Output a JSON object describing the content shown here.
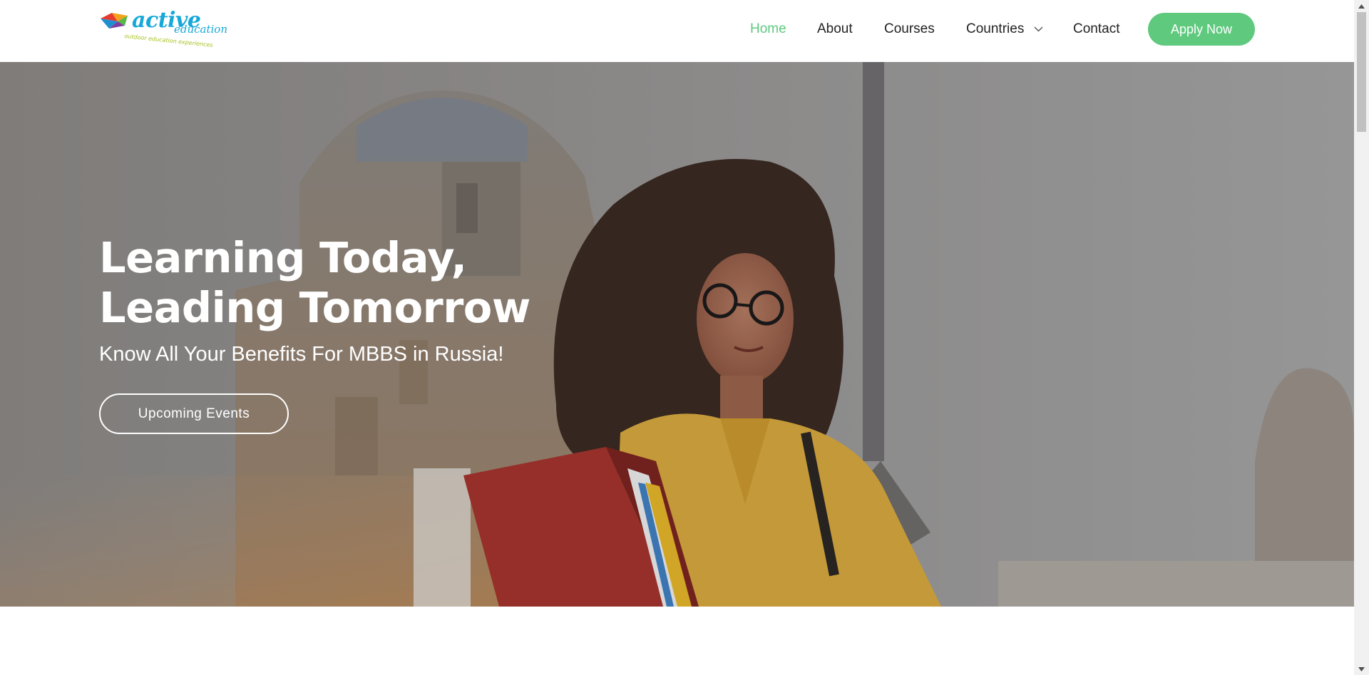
{
  "logo": {
    "word": "active",
    "word2": "education",
    "tagline": "outdoor education experiences",
    "icon": "kite-logo-icon"
  },
  "nav": {
    "items": [
      {
        "label": "Home",
        "active": true
      },
      {
        "label": "About",
        "active": false
      },
      {
        "label": "Courses",
        "active": false
      },
      {
        "label": "Countries",
        "active": false,
        "icon": "chevron-down-icon"
      },
      {
        "label": "Contact",
        "active": false
      }
    ],
    "cta_label": "Apply Now"
  },
  "hero": {
    "title_line1": "Learning Today,",
    "title_line2": "Leading Tomorrow",
    "subtitle": "Know All Your Benefits For MBBS in Russia!",
    "button_label": "Upcoming Events"
  },
  "colors": {
    "accent": "#5fc97e",
    "logo_blue": "#16a8d8",
    "logo_green": "#a8c31e",
    "nav_text": "#222222"
  }
}
